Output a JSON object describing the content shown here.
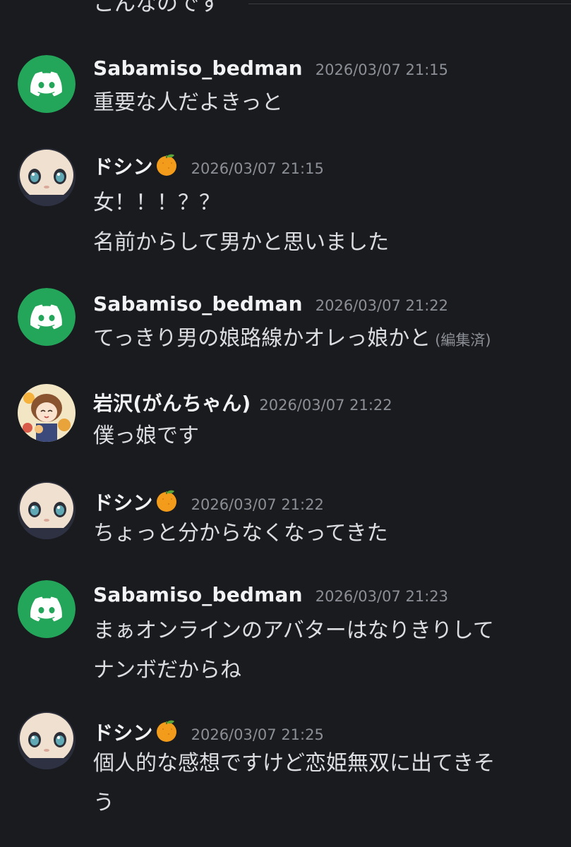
{
  "previous_message_tail": "こんなのです",
  "messages": [
    {
      "username": "Sabamiso_bedman",
      "timestamp": "2026/03/07 21:15",
      "lines": [
        "重要な人だよきっと"
      ]
    },
    {
      "username": "ドシン",
      "timestamp": "2026/03/07 21:15",
      "lines": [
        "女！！！？？",
        "名前からして男かと思いました"
      ]
    },
    {
      "username": "Sabamiso_bedman",
      "timestamp": "2026/03/07 21:22",
      "lines": [
        "てっきり男の娘路線かオレっ娘かと"
      ],
      "edited_label": "(編集済)"
    },
    {
      "username": "岩沢(がんちゃん)",
      "timestamp": "2026/03/07 21:22",
      "lines": [
        "僕っ娘です"
      ]
    },
    {
      "username": "ドシン",
      "timestamp": "2026/03/07 21:22",
      "lines": [
        "ちょっと分からなくなってきた"
      ]
    },
    {
      "username": "Sabamiso_bedman",
      "timestamp": "2026/03/07 21:23",
      "lines": [
        "まぁオンラインのアバターはなりきりして",
        "ナンボだからね"
      ]
    },
    {
      "username": "ドシン",
      "timestamp": "2026/03/07 21:25",
      "lines": [
        "個人的な感想ですけど恋姫無双に出てきそ",
        "う"
      ]
    }
  ],
  "colors": {
    "background": "#1a1b1f",
    "discord_green": "#23a55a",
    "username": "#f2f3f5",
    "timestamp": "#8c8f96",
    "message_text": "#dcdde1"
  },
  "icons": {
    "discord_default_avatar": "discord-logo-icon",
    "orange_emoji": "tangerine-emoji-icon"
  }
}
